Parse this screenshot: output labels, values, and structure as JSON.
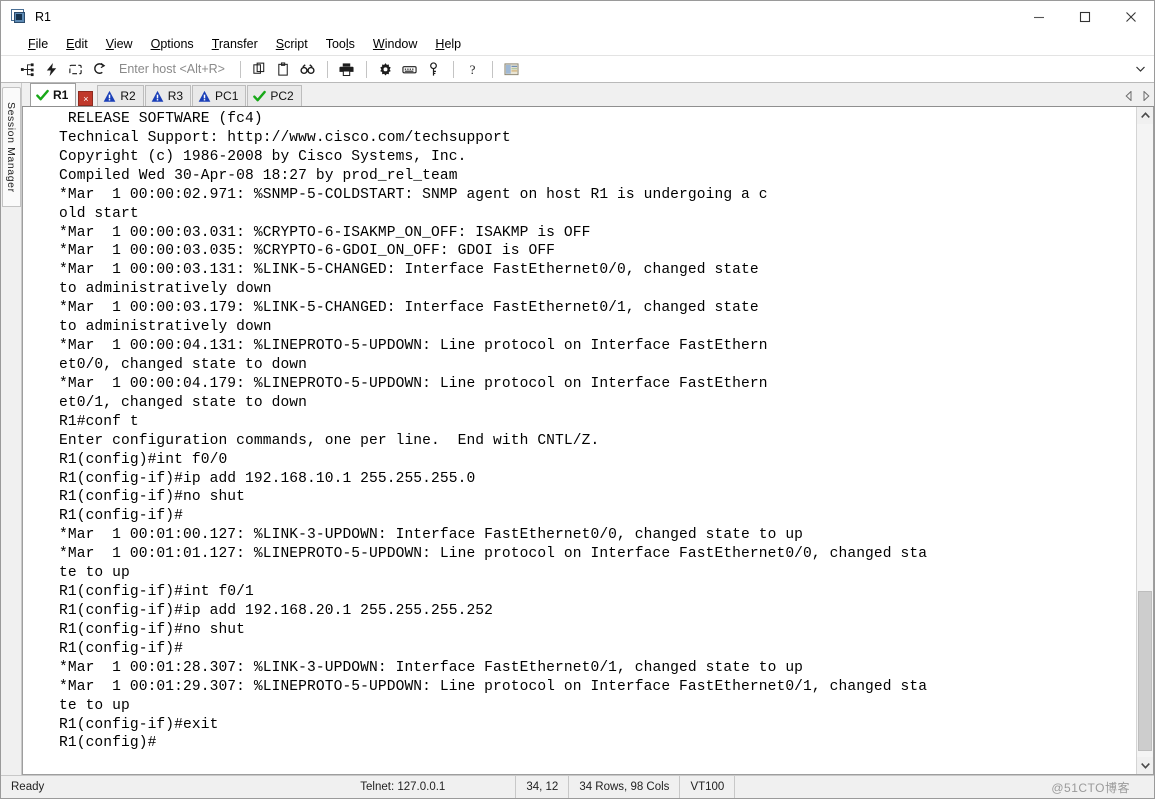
{
  "window": {
    "title": "R1",
    "icon": "session-window-icon",
    "minimize_label": "Minimize",
    "maximize_label": "Maximize",
    "close_label": "Close"
  },
  "menubar": {
    "items": [
      {
        "label": "File",
        "accel": "F"
      },
      {
        "label": "Edit",
        "accel": "E"
      },
      {
        "label": "View",
        "accel": "V"
      },
      {
        "label": "Options",
        "accel": "O"
      },
      {
        "label": "Transfer",
        "accel": "T"
      },
      {
        "label": "Script",
        "accel": "S"
      },
      {
        "label": "Tools",
        "accel": "l"
      },
      {
        "label": "Window",
        "accel": "W"
      },
      {
        "label": "Help",
        "accel": "H"
      }
    ]
  },
  "toolbar": {
    "host_placeholder": "Enter host <Alt+R>",
    "buttons": [
      {
        "name": "connect-icon",
        "title": "Connect"
      },
      {
        "name": "quick-connect-icon",
        "title": "Quick Connect"
      },
      {
        "name": "reconnect-icon",
        "title": "Reconnect"
      },
      {
        "name": "connect-in-tab-icon",
        "title": "Connect in Tab"
      },
      {
        "name": "copy-icon",
        "title": "Copy"
      },
      {
        "name": "paste-icon",
        "title": "Paste"
      },
      {
        "name": "find-icon",
        "title": "Find"
      },
      {
        "name": "print-icon",
        "title": "Print"
      },
      {
        "name": "session-options-icon",
        "title": "Session Options"
      },
      {
        "name": "keymap-editor-icon",
        "title": "Keymap Editor"
      },
      {
        "name": "key-icon",
        "title": "Key"
      },
      {
        "name": "help-icon",
        "title": "Help"
      },
      {
        "name": "session-manager-icon",
        "title": "Session Manager"
      }
    ],
    "overflow_label": "More toolbar buttons"
  },
  "sidebar": {
    "label": "Session Manager"
  },
  "tabs": {
    "items": [
      {
        "label": "R1",
        "status": "connected",
        "icon": "green-check-icon",
        "active": true,
        "closable": true
      },
      {
        "label": "R2",
        "status": "warning",
        "icon": "blue-warning-icon",
        "active": false,
        "closable": false
      },
      {
        "label": "R3",
        "status": "warning",
        "icon": "blue-warning-icon",
        "active": false,
        "closable": false
      },
      {
        "label": "PC1",
        "status": "warning",
        "icon": "blue-warning-icon",
        "active": false,
        "closable": false
      },
      {
        "label": "PC2",
        "status": "connected",
        "icon": "green-check-icon",
        "active": false,
        "closable": false
      }
    ],
    "close_glyph": "×",
    "nav_prev_label": "Scroll tabs left",
    "nav_next_label": "Scroll tabs right"
  },
  "terminal": {
    "lines": [
      " RELEASE SOFTWARE (fc4)",
      "Technical Support: http://www.cisco.com/techsupport",
      "Copyright (c) 1986-2008 by Cisco Systems, Inc.",
      "Compiled Wed 30-Apr-08 18:27 by prod_rel_team",
      "*Mar  1 00:00:02.971: %SNMP-5-COLDSTART: SNMP agent on host R1 is undergoing a c",
      "old start",
      "*Mar  1 00:00:03.031: %CRYPTO-6-ISAKMP_ON_OFF: ISAKMP is OFF",
      "*Mar  1 00:00:03.035: %CRYPTO-6-GDOI_ON_OFF: GDOI is OFF",
      "*Mar  1 00:00:03.131: %LINK-5-CHANGED: Interface FastEthernet0/0, changed state",
      "to administratively down",
      "*Mar  1 00:00:03.179: %LINK-5-CHANGED: Interface FastEthernet0/1, changed state",
      "to administratively down",
      "*Mar  1 00:00:04.131: %LINEPROTO-5-UPDOWN: Line protocol on Interface FastEthern",
      "et0/0, changed state to down",
      "*Mar  1 00:00:04.179: %LINEPROTO-5-UPDOWN: Line protocol on Interface FastEthern",
      "et0/1, changed state to down",
      "R1#conf t",
      "Enter configuration commands, one per line.  End with CNTL/Z.",
      "R1(config)#int f0/0",
      "R1(config-if)#ip add 192.168.10.1 255.255.255.0",
      "R1(config-if)#no shut",
      "R1(config-if)#",
      "*Mar  1 00:01:00.127: %LINK-3-UPDOWN: Interface FastEthernet0/0, changed state to up",
      "*Mar  1 00:01:01.127: %LINEPROTO-5-UPDOWN: Line protocol on Interface FastEthernet0/0, changed sta",
      "te to up",
      "R1(config-if)#int f0/1",
      "R1(config-if)#ip add 192.168.20.1 255.255.255.252",
      "R1(config-if)#no shut",
      "R1(config-if)#",
      "*Mar  1 00:01:28.307: %LINK-3-UPDOWN: Interface FastEthernet0/1, changed state to up",
      "*Mar  1 00:01:29.307: %LINEPROTO-5-UPDOWN: Line protocol on Interface FastEthernet0/1, changed sta",
      "te to up",
      "R1(config-if)#exit",
      "R1(config)#"
    ],
    "scroll_up_label": "Scroll up",
    "scroll_down_label": "Scroll down"
  },
  "statusbar": {
    "ready": "Ready",
    "protocol": "Telnet: 127.0.0.1",
    "cursor": "34, 12",
    "dimensions": "34 Rows, 98 Cols",
    "emulation": "VT100",
    "watermark": "@51CTO博客"
  },
  "colors": {
    "accent_blue": "#2255aa",
    "ok_green": "#20a020",
    "warn_blue": "#1a3fb8",
    "close_red": "#c0392b",
    "terminal_bg": "#ffffff",
    "terminal_fg": "#000000"
  }
}
